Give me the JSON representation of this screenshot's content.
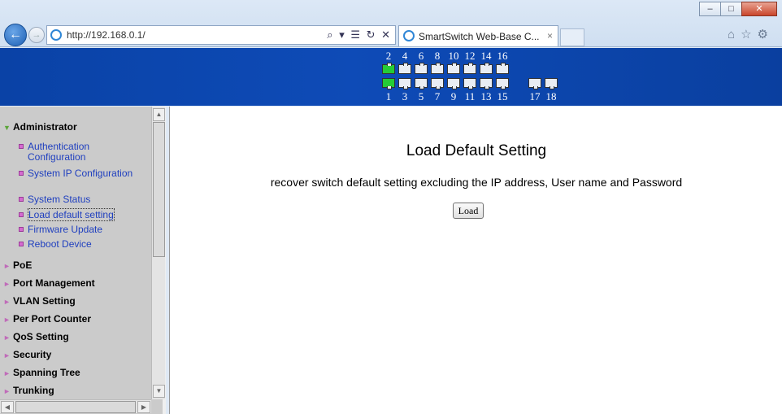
{
  "browser": {
    "url": "http://192.168.0.1/",
    "address_tools": "⌕ ▾ ☰ ↻ ✕",
    "tab_title": "SmartSwitch Web-Base C...",
    "tab_close": "×",
    "window_buttons": {
      "minimize": "–",
      "maximize": "□",
      "close": "✕"
    },
    "right_tools": "⌂☆⚙"
  },
  "banner": {
    "top_port_labels": [
      "2",
      "4",
      "6",
      "8",
      "10",
      "12",
      "14",
      "16"
    ],
    "bottom_port_labels": [
      "1",
      "3",
      "5",
      "7",
      "9",
      "11",
      "13",
      "15",
      "17",
      "18"
    ],
    "port1_status_color": "#25cc36"
  },
  "sidebar": {
    "sections": [
      {
        "label": "Administrator",
        "expanded": true
      },
      {
        "label": "PoE"
      },
      {
        "label": "Port Management"
      },
      {
        "label": "VLAN Setting"
      },
      {
        "label": "Per Port Counter"
      },
      {
        "label": "QoS Setting"
      },
      {
        "label": "Security"
      },
      {
        "label": "Spanning Tree"
      },
      {
        "label": "Trunking"
      }
    ],
    "admin_items": [
      "Authentication Configuration",
      "System IP Configuration",
      "System Status",
      "Load default setting",
      "Firmware Update",
      "Reboot Device"
    ],
    "selected_item": "Load default setting"
  },
  "main": {
    "title": "Load Default Setting",
    "description": "recover switch default setting excluding the IP address, User name and Password",
    "load_button": "Load"
  }
}
